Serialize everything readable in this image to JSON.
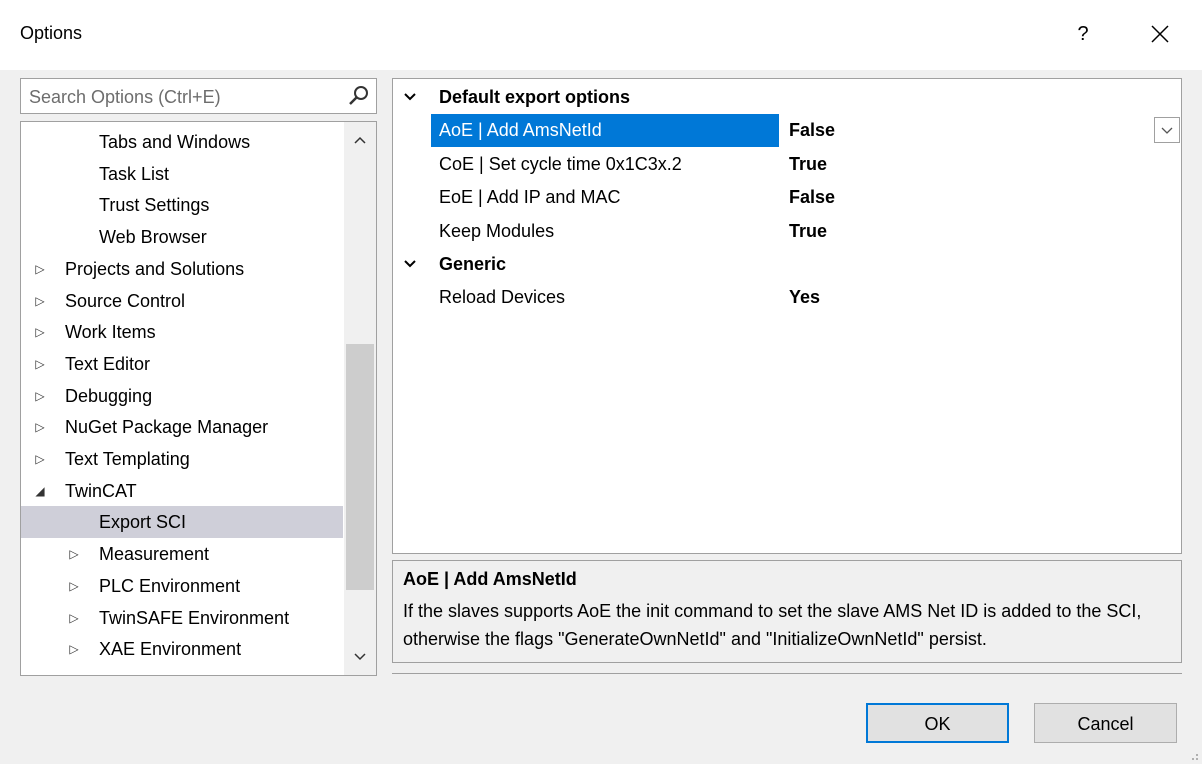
{
  "window": {
    "title": "Options",
    "help_label": "?",
    "close_icon": "close-icon"
  },
  "search": {
    "placeholder": "Search Options (Ctrl+E)",
    "icon": "search-icon"
  },
  "tree": {
    "items": [
      {
        "label": "Tabs and Windows",
        "expander": ""
      },
      {
        "label": "Task List",
        "expander": ""
      },
      {
        "label": "Trust Settings",
        "expander": ""
      },
      {
        "label": "Web Browser",
        "expander": ""
      },
      {
        "label": "Projects and Solutions",
        "expander": "▷"
      },
      {
        "label": "Source Control",
        "expander": "▷"
      },
      {
        "label": "Work Items",
        "expander": "▷"
      },
      {
        "label": "Text Editor",
        "expander": "▷"
      },
      {
        "label": "Debugging",
        "expander": "▷"
      },
      {
        "label": "NuGet Package Manager",
        "expander": "▷"
      },
      {
        "label": "Text Templating",
        "expander": "▷"
      },
      {
        "label": "TwinCAT",
        "expander": "◢"
      },
      {
        "label": "Export SCI",
        "expander": "",
        "selected": true
      },
      {
        "label": "Measurement",
        "expander": "▷"
      },
      {
        "label": "PLC Environment",
        "expander": "▷"
      },
      {
        "label": "TwinSAFE Environment",
        "expander": "▷"
      },
      {
        "label": "XAE Environment",
        "expander": "▷"
      }
    ]
  },
  "properties": {
    "categories": [
      {
        "label": "Default export options",
        "items": [
          {
            "name": "AoE | Add AmsNetId",
            "value": "False",
            "selected": true
          },
          {
            "name": "CoE | Set cycle time 0x1C3x.2",
            "value": "True"
          },
          {
            "name": "EoE | Add IP and MAC",
            "value": "False"
          },
          {
            "name": "Keep Modules",
            "value": "True"
          }
        ]
      },
      {
        "label": "Generic",
        "items": [
          {
            "name": "Reload Devices",
            "value": "Yes"
          }
        ]
      }
    ]
  },
  "description": {
    "title": "AoE | Add AmsNetId",
    "text": "If the slaves supports AoE the init command to set the slave AMS Net ID is added to the SCI, otherwise the flags \"GenerateOwnNetId\" and \"InitializeOwnNetId\" persist."
  },
  "buttons": {
    "ok": "OK",
    "cancel": "Cancel"
  },
  "colors": {
    "selection": "#0078d7",
    "tree_selection": "#cfcfd9",
    "background": "#f0f0f0"
  }
}
